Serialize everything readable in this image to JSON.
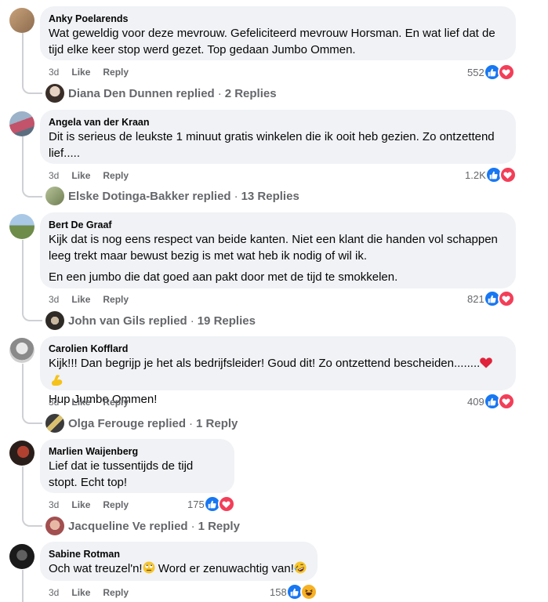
{
  "comments": [
    {
      "author": "Anky Poelarends",
      "paragraphs": [
        "Wat geweldig voor deze mevrouw. Gefeliciteerd mevrouw Horsman. En wat lief dat de tijd elke keer stop werd gezet. Top gedaan Jumbo Ommen."
      ],
      "age": "3d",
      "like_label": "Like",
      "reply_label": "Reply",
      "reaction_count": "552",
      "reactions": [
        "like-icon",
        "love-icon"
      ],
      "replied_by": "Diana Den Dunnen replied",
      "replies": "2 Replies"
    },
    {
      "author": "Angela van der Kraan",
      "paragraphs": [
        "Dit is serieus de leukste 1 minuut gratis winkelen die ik ooit heb gezien. Zo ontzettend lief....."
      ],
      "age": "3d",
      "like_label": "Like",
      "reply_label": "Reply",
      "reaction_count": "1.2K",
      "reactions": [
        "like-icon",
        "love-icon"
      ],
      "replied_by": "Elske Dotinga-Bakker replied",
      "replies": "13 Replies"
    },
    {
      "author": "Bert De Graaf",
      "paragraphs": [
        "Kijk dat is nog eens respect van beide kanten. Niet een klant die handen vol schappen leeg trekt maar bewust bezig is met wat heb ik nodig of wil ik.",
        "En een jumbo die dat goed aan pakt door met de tijd te smokkelen."
      ],
      "age": "3d",
      "like_label": "Like",
      "reply_label": "Reply",
      "reaction_count": "821",
      "reactions": [
        "like-icon",
        "love-icon"
      ],
      "replied_by": "John van Gils replied",
      "replies": "19 Replies"
    },
    {
      "author": "Carolien Kofflard",
      "line1": "Kijk!!! Dan begrijp je het als bedrijfsleider! Goud dit! Zo ontzettend bescheiden........",
      "line2": "Hup Jumbo Ommen!",
      "age": "3d",
      "like_label": "Like",
      "reply_label": "Reply",
      "reaction_count": "409",
      "reactions": [
        "like-icon",
        "love-icon"
      ],
      "replied_by": "Olga Ferouge replied",
      "replies": "1 Reply"
    },
    {
      "author": "Marlien Waijenberg",
      "paragraphs": [
        "Lief dat ie tussentijds de tijd stopt. Echt top!"
      ],
      "age": "3d",
      "like_label": "Like",
      "reply_label": "Reply",
      "reaction_count": "175",
      "reactions": [
        "like-icon",
        "love-icon"
      ],
      "replied_by": "Jacqueline Ve replied",
      "replies": "1 Reply"
    },
    {
      "author": "Sabine Rotman",
      "text_a": "Och wat treuzel'n!",
      "text_b": " Word er zenuwachtig van!",
      "age": "3d",
      "like_label": "Like",
      "reply_label": "Reply",
      "reaction_count": "158",
      "reactions": [
        "like-icon",
        "haha-icon"
      ]
    }
  ],
  "separator": "·",
  "colors": {
    "like": "#1877f2",
    "love": "#f33e58",
    "haha": "#f7b125",
    "bubble": "#f0f2f5",
    "muted": "#65676b"
  }
}
